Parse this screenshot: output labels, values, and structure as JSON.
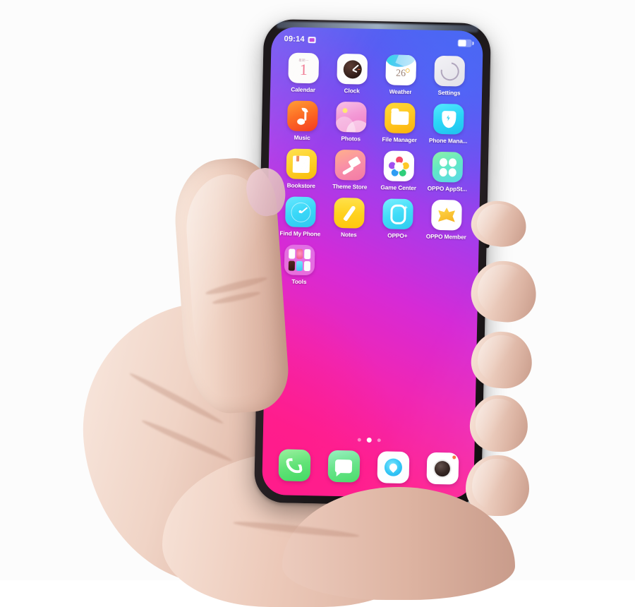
{
  "scene": {
    "description": "hand-holding-smartphone",
    "background_color": "#fcfcfc"
  },
  "phone": {
    "frame_color": "#1a1618",
    "side_button": "power-button"
  },
  "status_bar": {
    "time": "09:14",
    "alarm_icon": "alarm-icon",
    "battery_icon": "battery-icon"
  },
  "wallpaper": {
    "gradient_from": "#ff1e8e",
    "gradient_mid": "#a83bea",
    "gradient_to": "#4a66f0"
  },
  "home_screen": {
    "rows": [
      [
        {
          "label": "Calendar",
          "icon": "calendar-icon",
          "badge_week": "星期一",
          "badge_day": "1"
        },
        {
          "label": "Clock",
          "icon": "clock-icon"
        },
        {
          "label": "Weather",
          "icon": "weather-icon",
          "temperature": "26"
        },
        {
          "label": "Settings",
          "icon": "settings-icon"
        }
      ],
      [
        {
          "label": "Music",
          "icon": "music-icon"
        },
        {
          "label": "Photos",
          "icon": "photos-icon"
        },
        {
          "label": "File Manager",
          "icon": "file-manager-icon"
        },
        {
          "label": "Phone Mana...",
          "icon": "phone-manager-icon"
        }
      ],
      [
        {
          "label": "Bookstore",
          "icon": "bookstore-icon"
        },
        {
          "label": "Theme Store",
          "icon": "theme-store-icon"
        },
        {
          "label": "Game Center",
          "icon": "game-center-icon"
        },
        {
          "label": "OPPO AppSt...",
          "icon": "oppo-appstore-icon"
        }
      ],
      [
        {
          "label": "Find My Phone",
          "icon": "find-my-phone-icon"
        },
        {
          "label": "Notes",
          "icon": "notes-icon"
        },
        {
          "label": "OPPO+",
          "icon": "oppo-plus-icon"
        },
        {
          "label": "OPPO Member",
          "icon": "oppo-member-icon"
        }
      ],
      [
        {
          "label": "Tools",
          "icon": "tools-folder-icon"
        }
      ]
    ]
  },
  "page_indicator": {
    "total": 3,
    "active_index": 1
  },
  "dock": {
    "items": [
      {
        "label": "Phone",
        "icon": "phone-dial-icon"
      },
      {
        "label": "Messages",
        "icon": "message-bubble-icon"
      },
      {
        "label": "Browser",
        "icon": "browser-globe-icon"
      },
      {
        "label": "Camera",
        "icon": "camera-lens-icon"
      }
    ]
  }
}
